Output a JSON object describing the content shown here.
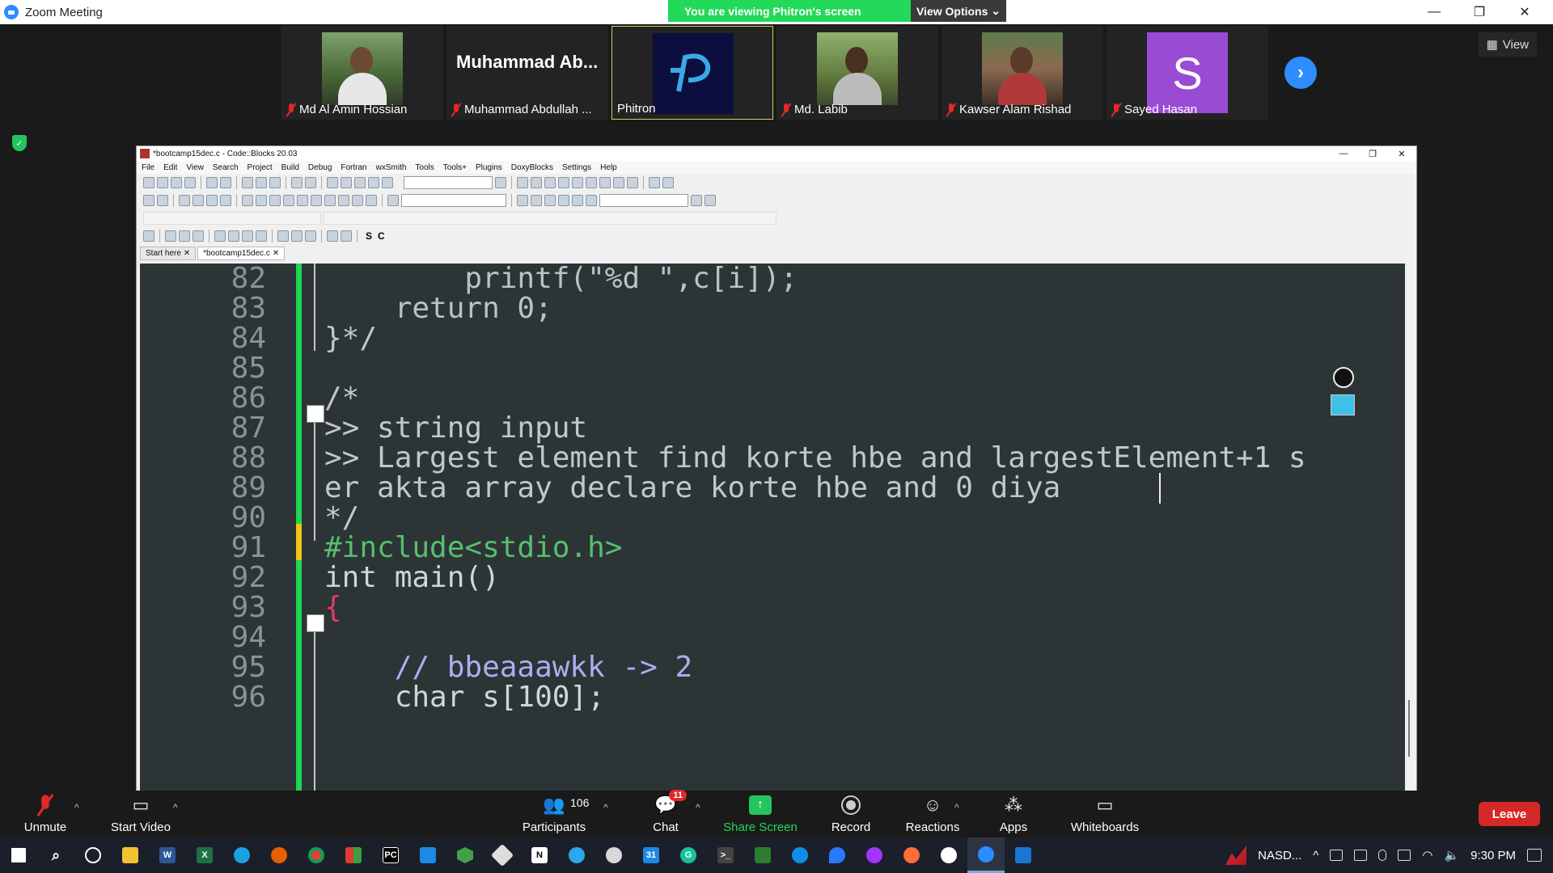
{
  "zoom": {
    "window_title": "Zoom Meeting",
    "banner": "You are viewing Phitron's screen",
    "view_options": "View Options",
    "view_label": "View",
    "participants_strip": [
      {
        "name": "Md Al Amin Hossian",
        "muted": true,
        "type": "photo"
      },
      {
        "name": "Muhammad Abdullah ...",
        "display_name": "Muhammad  Ab...",
        "muted": true,
        "type": "text"
      },
      {
        "name": "Phitron",
        "muted": false,
        "type": "logo"
      },
      {
        "name": "Md. Labib",
        "muted": true,
        "type": "photo"
      },
      {
        "name": "Kawser Alam Rishad",
        "muted": true,
        "type": "photo"
      },
      {
        "name": "Sayed Hasan",
        "muted": true,
        "type": "avatar",
        "initial": "S"
      }
    ],
    "controls": {
      "unmute": "Unmute",
      "start_video": "Start Video",
      "participants": "Participants",
      "participants_count": "106",
      "chat": "Chat",
      "chat_badge": "11",
      "share_screen": "Share Screen",
      "record": "Record",
      "reactions": "Reactions",
      "apps": "Apps",
      "whiteboards": "Whiteboards",
      "leave": "Leave"
    }
  },
  "codeblocks": {
    "title": "*bootcamp15dec.c - Code::Blocks 20.03",
    "menu": [
      "File",
      "Edit",
      "View",
      "Search",
      "Project",
      "Build",
      "Debug",
      "Fortran",
      "wxSmith",
      "Tools",
      "Tools+",
      "Plugins",
      "DoxyBlocks",
      "Settings",
      "Help"
    ],
    "tabs": [
      {
        "label": "Start here",
        "active": false
      },
      {
        "label": "*bootcamp15dec.c",
        "active": true
      }
    ],
    "lines": [
      {
        "n": "82",
        "text": "        printf(\"%d \",c[i]);"
      },
      {
        "n": "83",
        "text": "    return 0;"
      },
      {
        "n": "84",
        "text": "}*/"
      },
      {
        "n": "85",
        "text": ""
      },
      {
        "n": "86",
        "text": "/*"
      },
      {
        "n": "87",
        "text": ">> string input"
      },
      {
        "n": "88",
        "text": ">> Largest element find korte hbe and largestElement+1 s"
      },
      {
        "n": "89",
        "text": "er akta array declare korte hbe and 0 diya "
      },
      {
        "n": "90",
        "text": "*/"
      },
      {
        "n": "91",
        "text": "#include<stdio.h>"
      },
      {
        "n": "92",
        "text": "int main()"
      },
      {
        "n": "93",
        "text": "{"
      },
      {
        "n": "94",
        "text": ""
      },
      {
        "n": "95",
        "text": "    // bbeaaawkk -> 2"
      },
      {
        "n": "96",
        "text": "    char s[100];"
      }
    ]
  },
  "taskbar": {
    "tray_ticker": "NASD...",
    "time": "9:30 PM"
  },
  "colors": {
    "zoom_green": "#23d959",
    "zoom_blue": "#2d8cff",
    "leave_red": "#d52828",
    "editor_bg": "#2d3436",
    "gutter_green": "#1fd655",
    "gutter_yellow": "#f2c418"
  }
}
